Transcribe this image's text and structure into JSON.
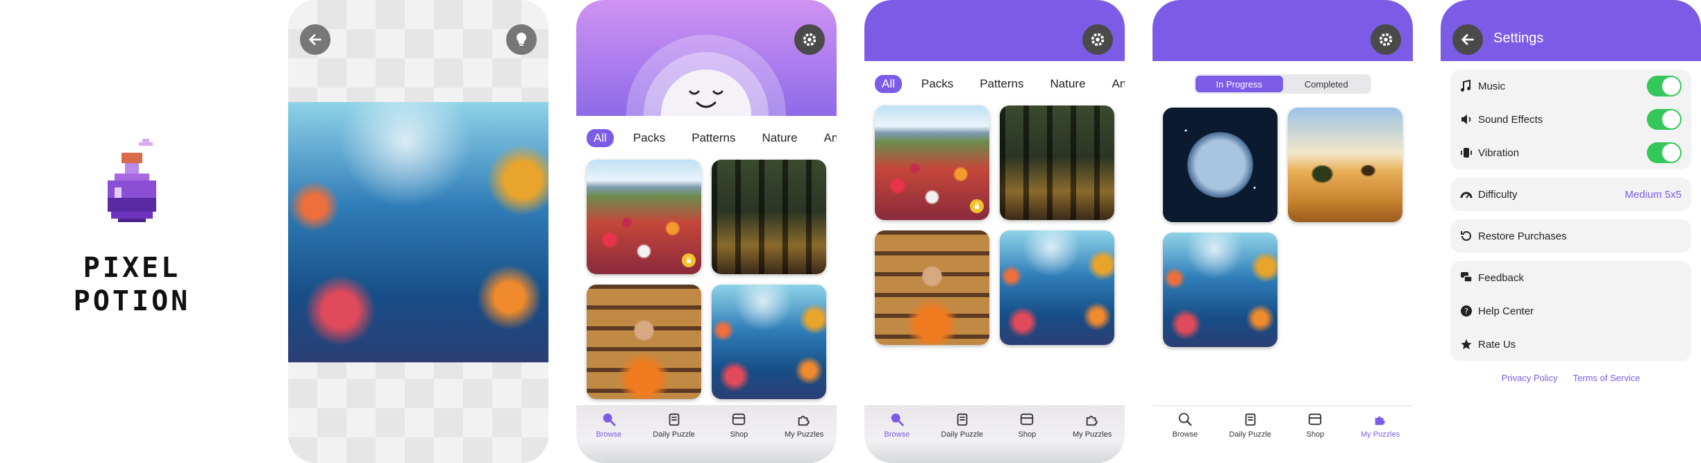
{
  "logo": {
    "line1": "PIXEL",
    "line2": "POTION"
  },
  "categories": [
    "All",
    "Packs",
    "Patterns",
    "Nature",
    "Animals"
  ],
  "tabs": [
    {
      "label": "Browse",
      "icon": "search-icon"
    },
    {
      "label": "Daily Puzzle",
      "icon": "calendar-icon"
    },
    {
      "label": "Shop",
      "icon": "store-icon"
    },
    {
      "label": "My Puzzles",
      "icon": "puzzle-icon"
    }
  ],
  "my_puzzles": {
    "segments": [
      "In Progress",
      "Completed"
    ]
  },
  "settings": {
    "title": "Settings",
    "music": "Music",
    "sound_effects": "Sound Effects",
    "vibration": "Vibration",
    "difficulty": "Difficulty",
    "difficulty_value": "Medium 5x5",
    "restore": "Restore Purchases",
    "feedback": "Feedback",
    "help": "Help Center",
    "rate": "Rate Us",
    "privacy": "Privacy Policy",
    "terms": "Terms of Service"
  },
  "colors": {
    "accent": "#7c5ce6",
    "toggle_on": "#34c759",
    "lock": "#f2c22e"
  }
}
